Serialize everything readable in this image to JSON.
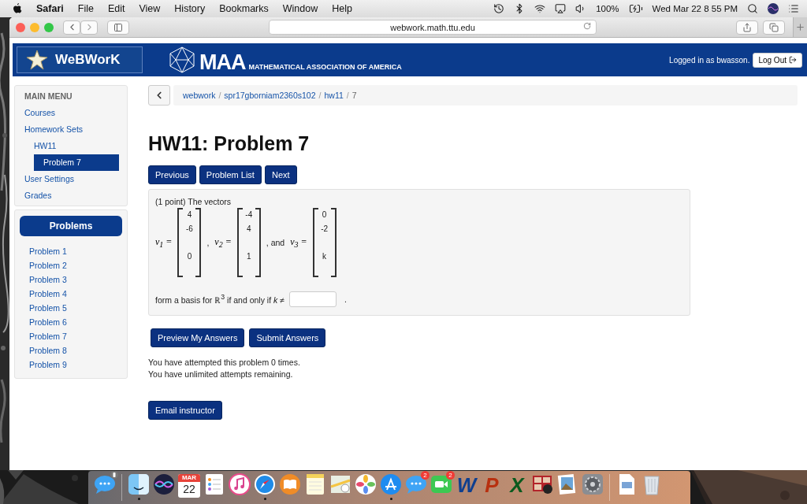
{
  "menu_bar": {
    "app": "Safari",
    "menus": [
      "File",
      "Edit",
      "View",
      "History",
      "Bookmarks",
      "Window",
      "Help"
    ],
    "battery": "100%",
    "clock": "Wed Mar 22  8 55 PM"
  },
  "browser": {
    "url": "webwork.math.ttu.edu"
  },
  "header": {
    "logo": "WeBWorK",
    "maa": "MAA",
    "maa_full": "MATHEMATICAL ASSOCIATION OF AMERICA",
    "logged_in": "Logged in as bwasson.",
    "logout": "Log Out"
  },
  "main_menu": {
    "title": "MAIN MENU",
    "items": [
      {
        "label": "Courses",
        "selected": false
      },
      {
        "label": "Homework Sets",
        "selected": false,
        "children": [
          {
            "label": "HW11",
            "selected": false,
            "children": [
              {
                "label": "Problem 7",
                "selected": true
              }
            ]
          }
        ]
      },
      {
        "label": "User Settings",
        "selected": false
      },
      {
        "label": "Grades",
        "selected": false
      }
    ]
  },
  "problems": {
    "title": "Problems",
    "items": [
      "Problem 1",
      "Problem 2",
      "Problem 3",
      "Problem 4",
      "Problem 5",
      "Problem 6",
      "Problem 7",
      "Problem 8",
      "Problem 9"
    ]
  },
  "breadcrumb": [
    {
      "label": "webwork",
      "kind": "link"
    },
    {
      "label": "/",
      "kind": "separator"
    },
    {
      "label": "spr17gborniam2360s102",
      "kind": "link"
    },
    {
      "label": "/",
      "kind": "separator"
    },
    {
      "label": "hw11",
      "kind": "link"
    },
    {
      "label": "/",
      "kind": "separator"
    },
    {
      "label": "7",
      "kind": "current"
    }
  ],
  "title": "HW11: Problem 7",
  "nav_buttons": [
    "Previous",
    "Problem List",
    "Next"
  ],
  "problem": {
    "intro": "(1 point) The vectors",
    "vectors": [
      {
        "label": "v$_{1}$ =",
        "entries": [
          "4",
          "-6",
          "0"
        ],
        "after": ","
      },
      {
        "label": "v$_{2}$ =",
        "entries": [
          "-4",
          "4",
          "1"
        ],
        "after": ", and"
      },
      {
        "label": "v$_{3}$ =",
        "entries": [
          "0",
          "-2",
          "k"
        ]
      }
    ],
    "question": "form a basis for ℝ$^{3}$ if and only if *k* ≠",
    "end": "."
  },
  "answer_buttons": [
    "Preview My Answers",
    "Submit Answers"
  ],
  "attempts": [
    "You have attempted this problem 0 times.",
    "You have unlimited attempts remaining."
  ],
  "email_button": "Email instructor",
  "dock": [
    {
      "kind": "messages",
      "running": false,
      "pin": true
    },
    {
      "kind": "divider"
    },
    {
      "kind": "finder",
      "running": true
    },
    {
      "kind": "siri",
      "running": false
    },
    {
      "kind": "calendar",
      "running": false,
      "month": "MAR",
      "day": "22"
    },
    {
      "kind": "reminders",
      "running": false
    },
    {
      "kind": "music",
      "running": false
    },
    {
      "kind": "compass",
      "running": true
    },
    {
      "kind": "books",
      "running": false
    },
    {
      "kind": "notes",
      "running": false
    },
    {
      "kind": "maps",
      "running": false
    },
    {
      "kind": "photos",
      "running": false
    },
    {
      "kind": "store",
      "running": true
    },
    {
      "kind": "messages",
      "running": false,
      "badge": "2"
    },
    {
      "kind": "facetime",
      "running": false,
      "badge": "2"
    },
    {
      "kind": "letter",
      "running": false,
      "glyph": "W",
      "color": "#0f3f8f"
    },
    {
      "kind": "letter",
      "running": false,
      "glyph": "P",
      "color": "#b8300f"
    },
    {
      "kind": "letter",
      "running": false,
      "glyph": "X",
      "color": "#0a5a1e"
    },
    {
      "kind": "photobooth",
      "running": false
    },
    {
      "kind": "preview",
      "running": false
    },
    {
      "kind": "settings",
      "running": false
    },
    {
      "kind": "divider"
    },
    {
      "kind": "document",
      "running": false
    },
    {
      "kind": "trash",
      "running": false
    }
  ]
}
